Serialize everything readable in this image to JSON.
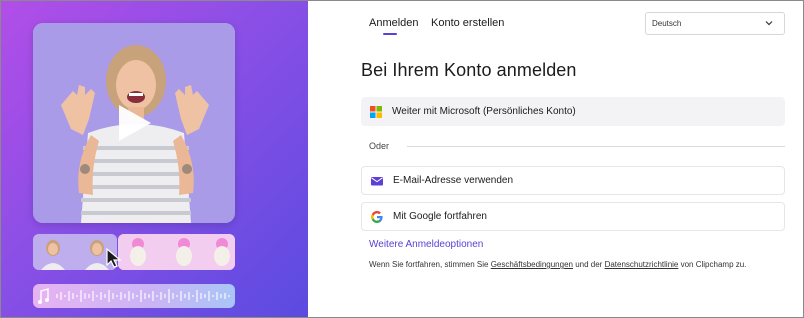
{
  "tabs": {
    "signin": "Anmelden",
    "create": "Konto erstellen"
  },
  "language": {
    "selected": "Deutsch"
  },
  "title": "Bei Ihrem Konto anmelden",
  "buttons": {
    "microsoft": "Weiter mit Microsoft (Persönliches Konto)",
    "email": "E-Mail-Adresse verwenden",
    "google": "Mit Google fortfahren"
  },
  "separator": "Oder",
  "more_options": "Weitere Anmeldeoptionen",
  "legal": {
    "prefix": "Wenn Sie fortfahren, stimmen Sie ",
    "terms": "Geschäftsbedingungen",
    "middle": " und der ",
    "privacy": "Datenschutzrichtlinie",
    "suffix": " von Clipchamp zu."
  },
  "colors": {
    "accent": "#5b3fd6",
    "panel_gradient_start": "#b24ee8",
    "panel_gradient_end": "#5a4be0"
  },
  "icons": {
    "play": "play-icon",
    "microsoft": "microsoft-logo-icon",
    "email": "mail-icon",
    "google": "google-logo-icon",
    "chevron": "chevron-down-icon",
    "music": "music-note-icon"
  }
}
